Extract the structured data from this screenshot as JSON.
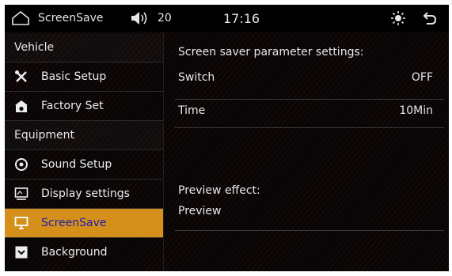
{
  "status_bar": {
    "title": "ScreenSave",
    "volume": "20",
    "time": "17:16",
    "icons": [
      "home-icon",
      "volume-icon",
      "brightness-icon",
      "back-icon"
    ]
  },
  "sidebar": {
    "section_vehicle": "Vehicle",
    "vehicle_items": [
      {
        "label": "Basic Setup",
        "icon": "tools-icon"
      },
      {
        "label": "Factory Set",
        "icon": "factory-icon"
      }
    ],
    "section_equipment": "Equipment",
    "equipment_items": [
      {
        "label": "Sound Setup",
        "icon": "sound-icon"
      },
      {
        "label": "Display settings",
        "icon": "display-icon"
      },
      {
        "label": "ScreenSave",
        "icon": "monitor-icon",
        "active": true
      },
      {
        "label": "Background",
        "icon": "background-icon"
      }
    ]
  },
  "main": {
    "heading": "Screen saver parameter settings:",
    "switch_label": "Switch",
    "switch_value": "OFF",
    "time_label": "Time",
    "time_value": "10Min",
    "preview_heading": "Preview effect:",
    "preview_button": "Preview"
  },
  "colors": {
    "active_bg": "#d4901a",
    "active_text": "#1e1eb0",
    "background": "#060606",
    "accent_lines": "#8a1212"
  }
}
